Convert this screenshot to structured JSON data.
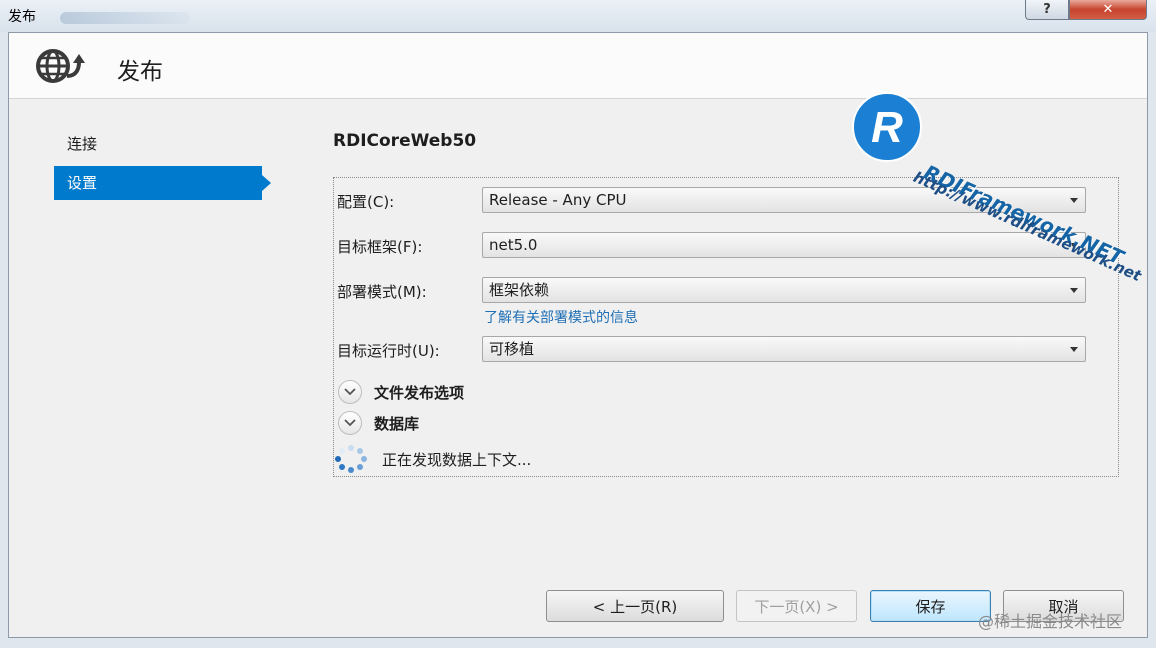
{
  "window": {
    "title": "发布",
    "help_label": "?",
    "close_label": "✕"
  },
  "header": {
    "title": "发布",
    "icon": "globe-publish-icon"
  },
  "sidebar": {
    "items": [
      {
        "label": "连接",
        "selected": false
      },
      {
        "label": "设置",
        "selected": true
      }
    ]
  },
  "settings": {
    "profile_name": "RDICoreWeb50",
    "configuration": {
      "label": "配置(C):",
      "value": "Release - Any CPU"
    },
    "target_framework": {
      "label": "目标框架(F):",
      "value": "net5.0"
    },
    "deployment_mode": {
      "label": "部署模式(M):",
      "value": "框架依赖"
    },
    "learn_more_link": "了解有关部署模式的信息",
    "target_runtime": {
      "label": "目标运行时(U):",
      "value": "可移植"
    },
    "file_publish_options": "文件发布选项",
    "databases": "数据库",
    "status": "正在发现数据上下文..."
  },
  "buttons": {
    "prev": "< 上一页(R)",
    "next": "下一页(X) >",
    "save": "保存",
    "cancel": "取消"
  },
  "watermarks": {
    "logo_letter": "R",
    "brand": "RDIFramework.NET",
    "url": "http://www.rdiframework.net",
    "community": "@稀土掘金技术社区"
  },
  "colors": {
    "accent": "#007acc",
    "link": "#1f6fb5",
    "close": "#c7442e"
  }
}
